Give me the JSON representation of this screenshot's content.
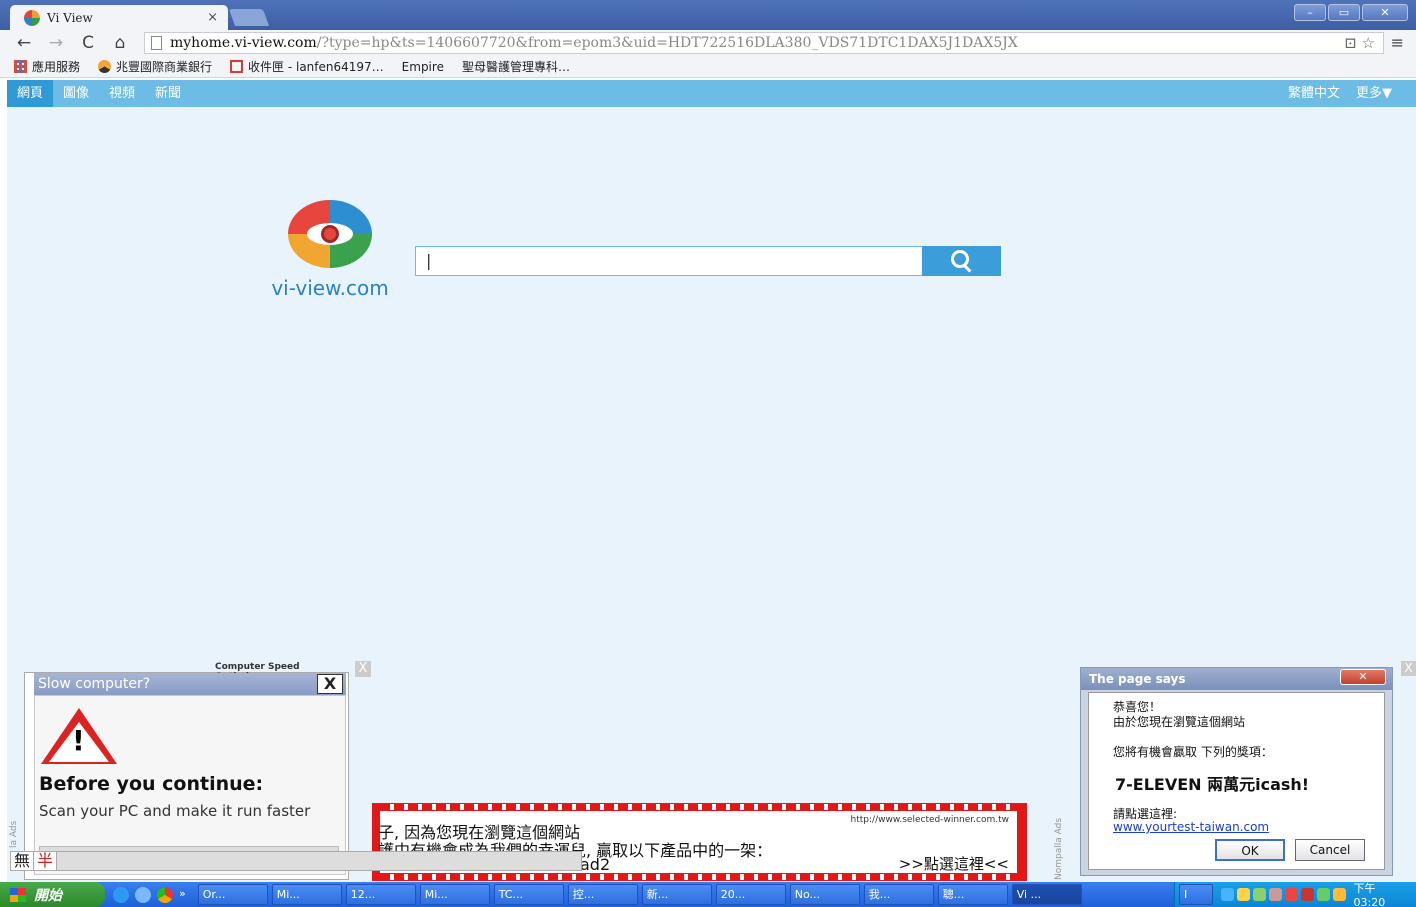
{
  "browser": {
    "tab_title": "Vi View",
    "tab_close": "×",
    "url_host": "myhome.vi-view.com",
    "url_path": "/?type=hp&ts=1406607720&from=epom3&uid=HDT722516DLA380_VDS71DTC1DAX5J1DAX5JX",
    "window_controls": [
      "–",
      "▭",
      "✕"
    ],
    "nav": {
      "back": "←",
      "forward": "→",
      "reload": "C",
      "home": "⌂"
    },
    "omni_icons": "⊡ ☆",
    "menu": "≡"
  },
  "bookmarks": [
    {
      "label": "應用服務",
      "icon": "apps-icon"
    },
    {
      "label": "兆豐國際商業銀行",
      "icon": "bank-icon"
    },
    {
      "label": "收件匣 - lanfen64197…",
      "icon": "gmail-icon"
    },
    {
      "label": "Empire",
      "icon": "page-icon"
    },
    {
      "label": "聖母醫護管理專科…",
      "icon": "page-icon"
    }
  ],
  "site": {
    "nav_items": [
      "網頁",
      "圖像",
      "視頻",
      "新聞"
    ],
    "nav_right": [
      "繁體中文",
      "更多▼"
    ],
    "logo_text": "vi-view.com",
    "search_value": "|",
    "brand_colors": {
      "primary": "#6cbce6",
      "button": "#3b9edb"
    }
  },
  "popup_left": {
    "caption": "Computer Speed Optimizer",
    "title": "Slow computer?",
    "close": "X",
    "warning": "!",
    "heading": "Before you continue:",
    "subtext": "Scan your PC and make it run faster",
    "side_label": "la Ads",
    "closex": "X"
  },
  "banner": {
    "url": "http://www.selected-winner.com.tw",
    "line1": "子, 因為您現在瀏覽這個網站",
    "line2": "護中有機會成為我們的幸運兒, 贏取以下產品中的一架：",
    "line3": "ad2",
    "cta": ">>點選這裡<<",
    "side_label": "Nompalla Ads"
  },
  "dialog": {
    "title": "The page says",
    "close": "✕",
    "line1": "恭喜您！",
    "line2": "由於您現在瀏覽這個網站",
    "line3": "您將有機會贏取 下列的獎項：",
    "prize": "7-ELEVEN 兩萬元icash!",
    "line4": "請點選這裡:",
    "link": "www.yourtest-taiwan.com",
    "ok": "OK",
    "cancel": "Cancel",
    "closex": "X"
  },
  "ime": {
    "mode1": "無",
    "mode2": "半"
  },
  "taskbar": {
    "start": "開始",
    "buttons": [
      "Or...",
      "Mi...",
      "12...",
      "Mi...",
      "TC...",
      "控...",
      "新...",
      "20...",
      "No...",
      "我...",
      "聰...",
      "Vi ...",
      "I"
    ],
    "chevron": "»",
    "clock": "下午 03:20"
  }
}
